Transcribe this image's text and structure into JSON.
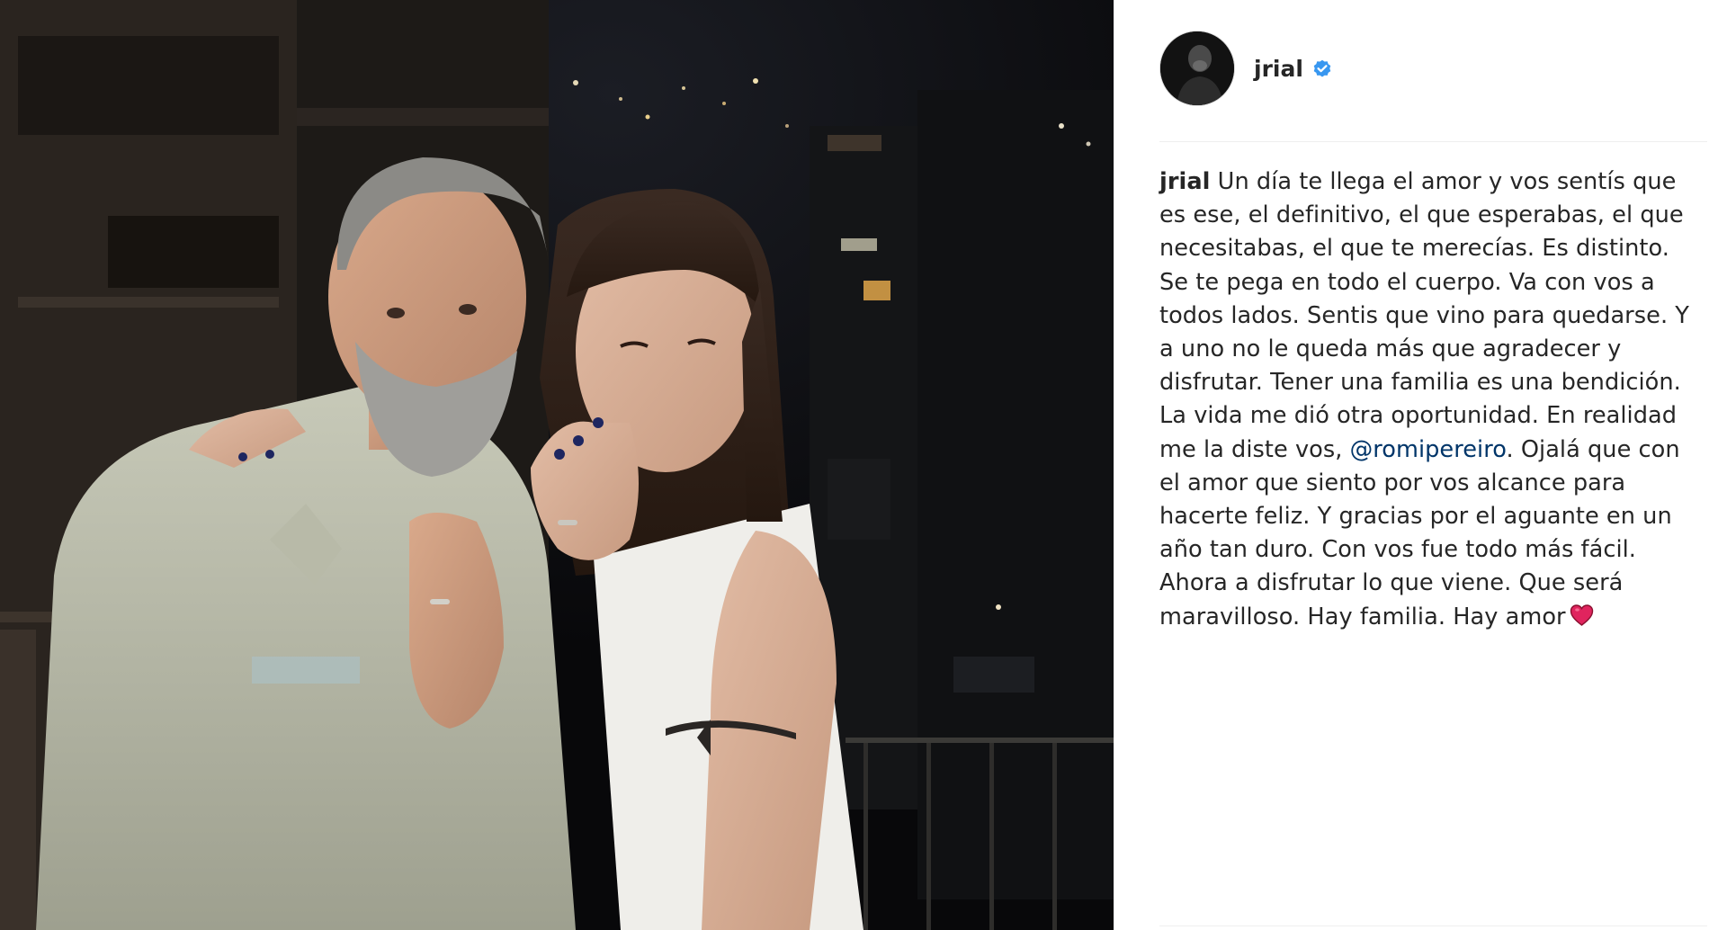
{
  "post": {
    "author": {
      "username": "jrial",
      "verified": true,
      "avatar_icon": "profile-avatar"
    },
    "caption": {
      "username": "jrial",
      "text_before_mention": "Un día te llega el amor y vos sentís que es ese, el definitivo, el que esperabas, el que necesitabas, el que te merecías. Es distinto. Se te pega en todo el cuerpo. Va con vos a todos lados. Sentis que vino para quedarse. Y a uno no le queda más que agradecer y disfrutar. Tener una familia es una bendición. La vida me dió otra oportunidad. En realidad me la diste vos, ",
      "mention": "@romipereiro",
      "text_after_mention": ". Ojalá que con el amor que siento por vos alcance para hacerte feliz. Y gracias por el aguante en un año tan duro. Con vos fue todo más fácil. Ahora a disfrutar lo que viene. Que será maravilloso. Hay familia. Hay amor",
      "emoji": "red-heart"
    },
    "photo": {
      "description_icon": "couple-photo"
    }
  },
  "colors": {
    "text": "#262626",
    "mention": "#003569",
    "verified_badge": "#3897f0",
    "heart": "#e0245e",
    "divider": "#efefef"
  }
}
